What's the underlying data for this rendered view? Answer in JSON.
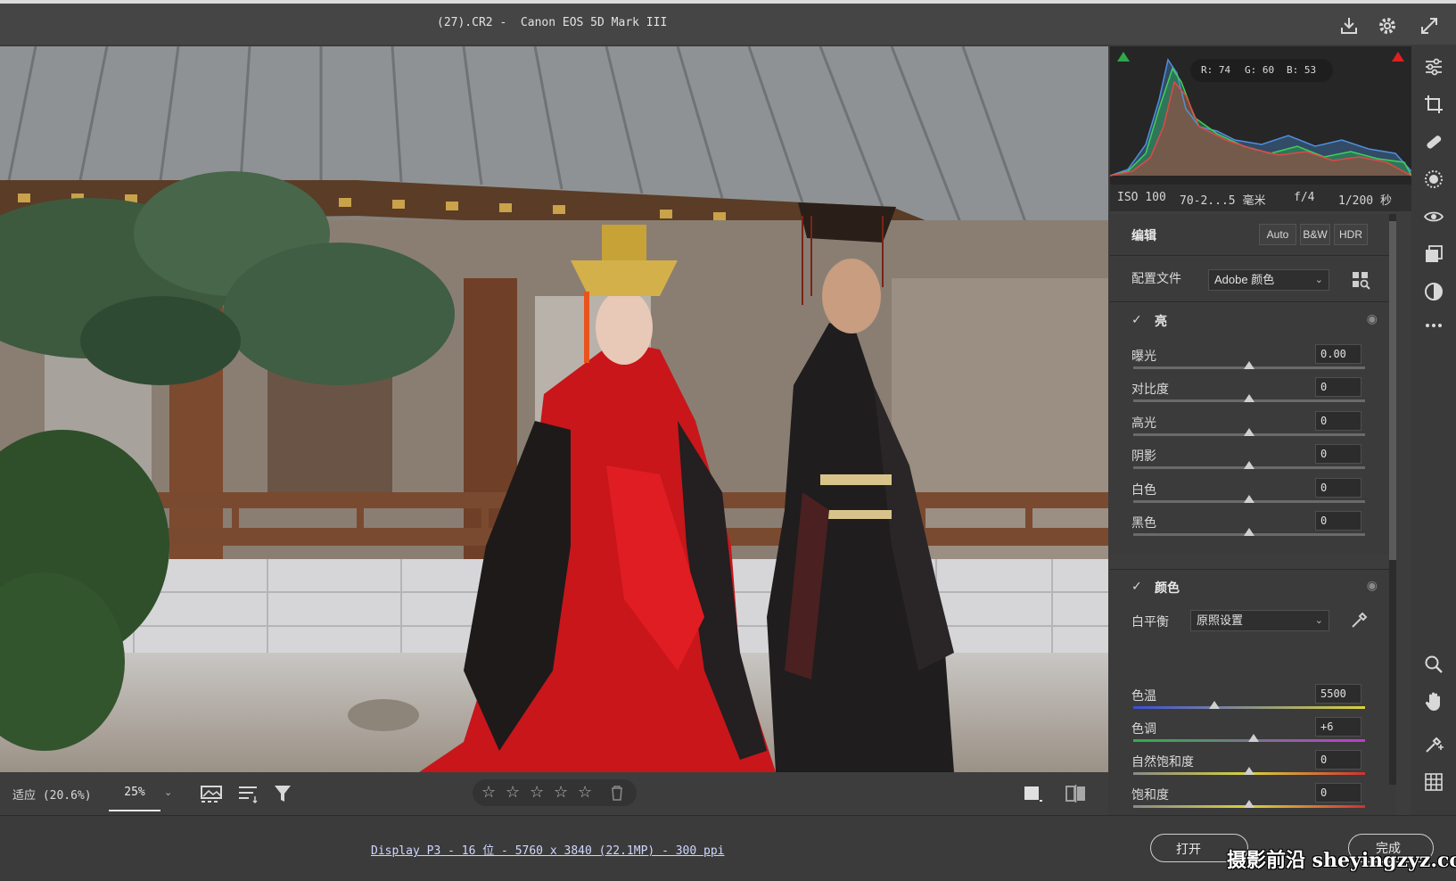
{
  "window": {
    "title": "(27).CR2 -  Canon EOS 5D Mark III"
  },
  "top_actions": {
    "save_icon": "download-icon",
    "settings_icon": "gear-icon",
    "fullscreen_icon": "expand-icon"
  },
  "histogram": {
    "rgb": {
      "r": "R: 74",
      "g": "G: 60",
      "b": "B: 53"
    },
    "shadow_clip_color": "#2ea84a",
    "highlight_clip_color": "#e02020"
  },
  "camera_info": {
    "iso": "ISO 100",
    "lens": "70-2...5 毫米",
    "aperture": "f/4",
    "shutter": "1/200 秒"
  },
  "edit": {
    "title": "编辑",
    "auto": "Auto",
    "bw": "B&W",
    "hdr": "HDR"
  },
  "profile": {
    "label": "配置文件",
    "value": "Adobe 颜色"
  },
  "light": {
    "title": "亮",
    "sliders": [
      {
        "label": "曝光",
        "value": "0.00",
        "position": 0.5
      },
      {
        "label": "对比度",
        "value": "0",
        "position": 0.5
      },
      {
        "label": "高光",
        "value": "0",
        "position": 0.5
      },
      {
        "label": "阴影",
        "value": "0",
        "position": 0.5
      },
      {
        "label": "白色",
        "value": "0",
        "position": 0.5
      },
      {
        "label": "黑色",
        "value": "0",
        "position": 0.5
      }
    ]
  },
  "color": {
    "title": "颜色",
    "wb_label": "白平衡",
    "wb_value": "原照设置",
    "sliders": [
      {
        "label": "色温",
        "value": "5500",
        "position": 0.35
      },
      {
        "label": "色调",
        "value": "+6",
        "position": 0.52
      },
      {
        "label": "自然饱和度",
        "value": "0",
        "position": 0.5
      },
      {
        "label": "饱和度",
        "value": "0",
        "position": 0.5
      }
    ]
  },
  "bottom_bar": {
    "fit_label": "适应 (20.6%)",
    "zoom_value": "25%",
    "rating_stars": 0
  },
  "status": {
    "doc_info": "Display P3 - 16 位 - 5760 x 3840 (22.1MP) - 300 ppi",
    "open_label": "打开",
    "done_label": "完成",
    "watermark": "摄影前沿 sheyingzyz.com"
  }
}
